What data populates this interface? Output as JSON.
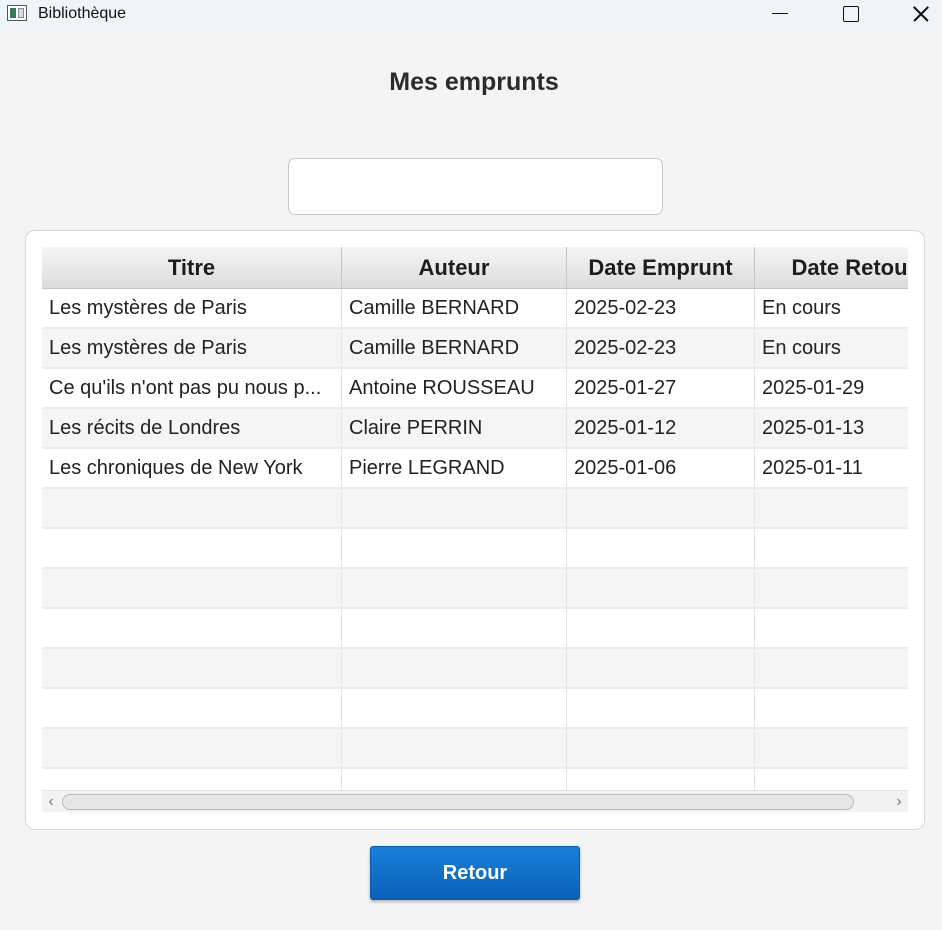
{
  "window": {
    "title": "Bibliothèque"
  },
  "page": {
    "title": "Mes emprunts"
  },
  "search": {
    "value": "",
    "placeholder": ""
  },
  "table": {
    "headers": [
      "Titre",
      "Auteur",
      "Date Emprunt",
      "Date Retou"
    ],
    "rows": [
      [
        "Les mystères de Paris",
        "Camille BERNARD",
        "2025-02-23",
        "En cours"
      ],
      [
        "Les mystères de Paris",
        "Camille BERNARD",
        "2025-02-23",
        "En cours"
      ],
      [
        "Ce qu'ils n'ont pas pu nous p...",
        "Antoine ROUSSEAU",
        "2025-01-27",
        "2025-01-29"
      ],
      [
        "Les récits de Londres",
        "Claire PERRIN",
        "2025-01-12",
        "2025-01-13"
      ],
      [
        "Les chroniques de New York",
        "Pierre LEGRAND",
        "2025-01-06",
        "2025-01-11"
      ]
    ]
  },
  "actions": {
    "back_label": "Retour"
  }
}
